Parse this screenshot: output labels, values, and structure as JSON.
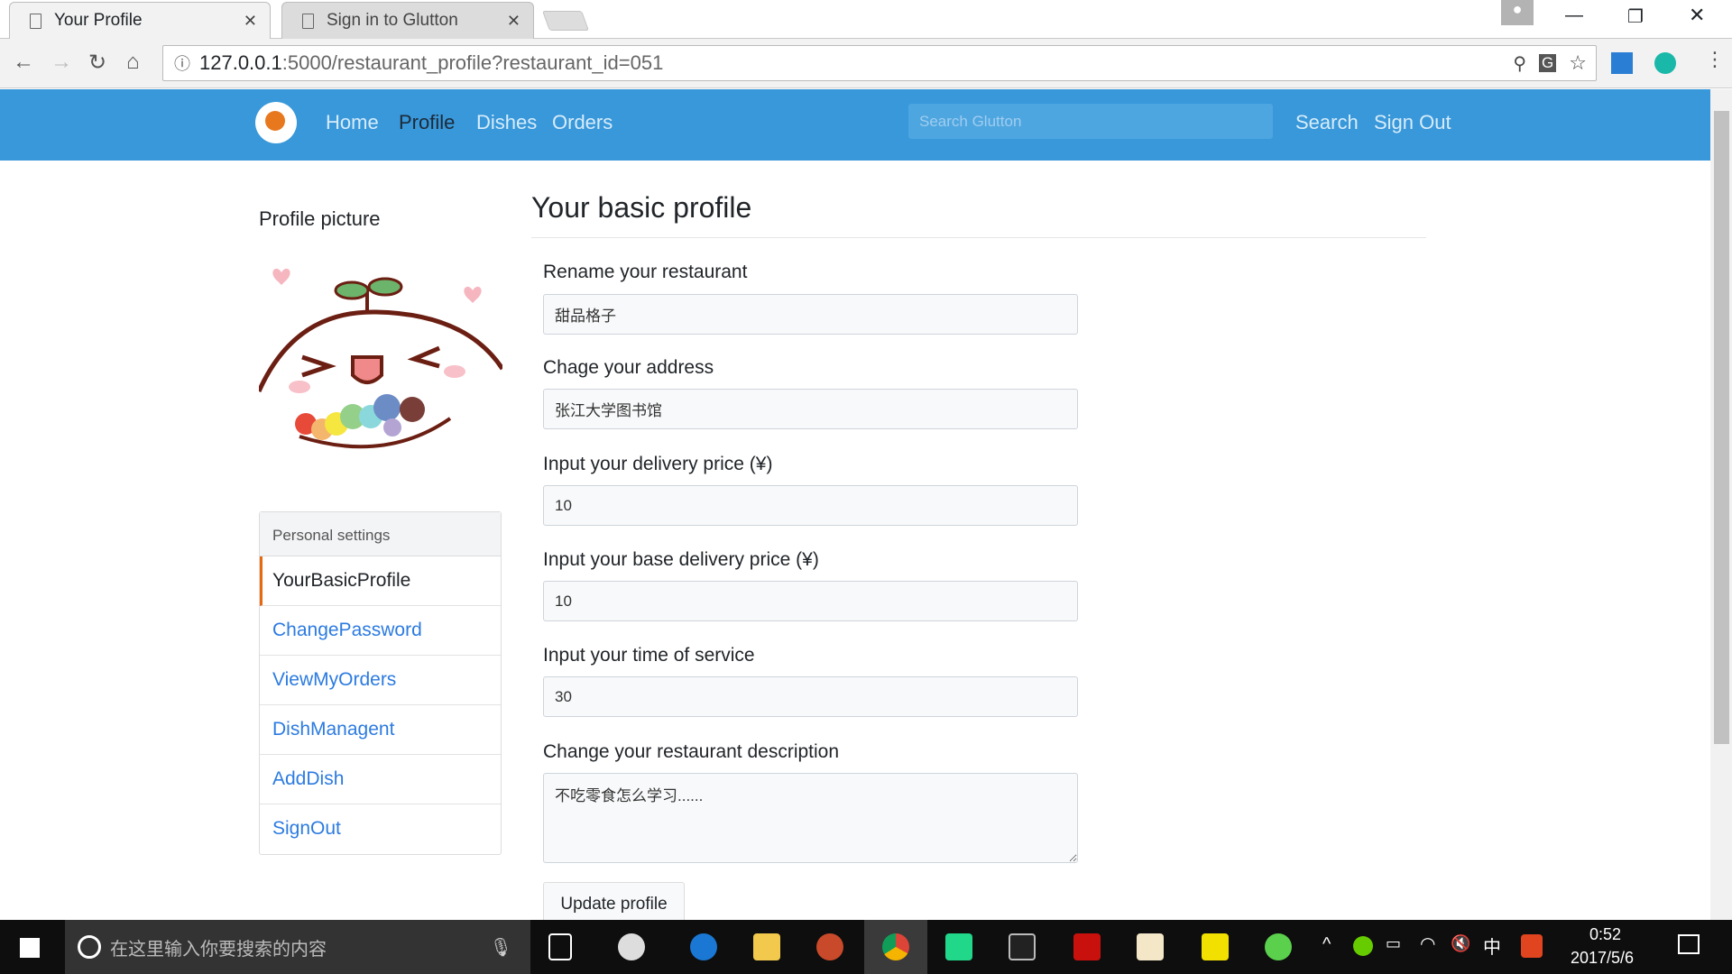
{
  "browser": {
    "tabs": [
      {
        "title": "Your Profile",
        "active": true
      },
      {
        "title": "Sign in to Glutton",
        "active": false
      }
    ],
    "url_host": "127.0.0.1",
    "url_rest": ":5000/restaurant_profile?restaurant_id=051"
  },
  "navbar": {
    "links": [
      "Home",
      "Profile",
      "Dishes",
      "Orders"
    ],
    "active": "Profile",
    "search_placeholder": "Search Glutton",
    "search_button": "Search",
    "signout": "Sign Out"
  },
  "sidebar": {
    "picture_title": "Profile picture",
    "settings_header": "Personal settings",
    "items": [
      "YourBasicProfile",
      "ChangePassword",
      "ViewMyOrders",
      "DishManagent",
      "AddDish",
      "SignOut"
    ]
  },
  "form": {
    "title": "Your basic profile",
    "fields": [
      {
        "label": "Rename your restaurant",
        "value": "甜品格子"
      },
      {
        "label": "Chage your address",
        "value": "张江大学图书馆"
      },
      {
        "label": "Input your delivery price (¥)",
        "value": "10"
      },
      {
        "label": "Input your base delivery price (¥)",
        "value": "10"
      },
      {
        "label": "Input your time of service",
        "value": "30"
      },
      {
        "label": "Change your restaurant description",
        "value": "不吃零食怎么学习......"
      }
    ],
    "submit": "Update profile"
  },
  "taskbar": {
    "search_placeholder": "在这里输入你要搜索的内容",
    "time": "0:52",
    "date": "2017/5/6",
    "ime": "中"
  },
  "colors": {
    "navbar": "#3898da",
    "link": "#2c7be0",
    "active_border": "#e8680f"
  }
}
